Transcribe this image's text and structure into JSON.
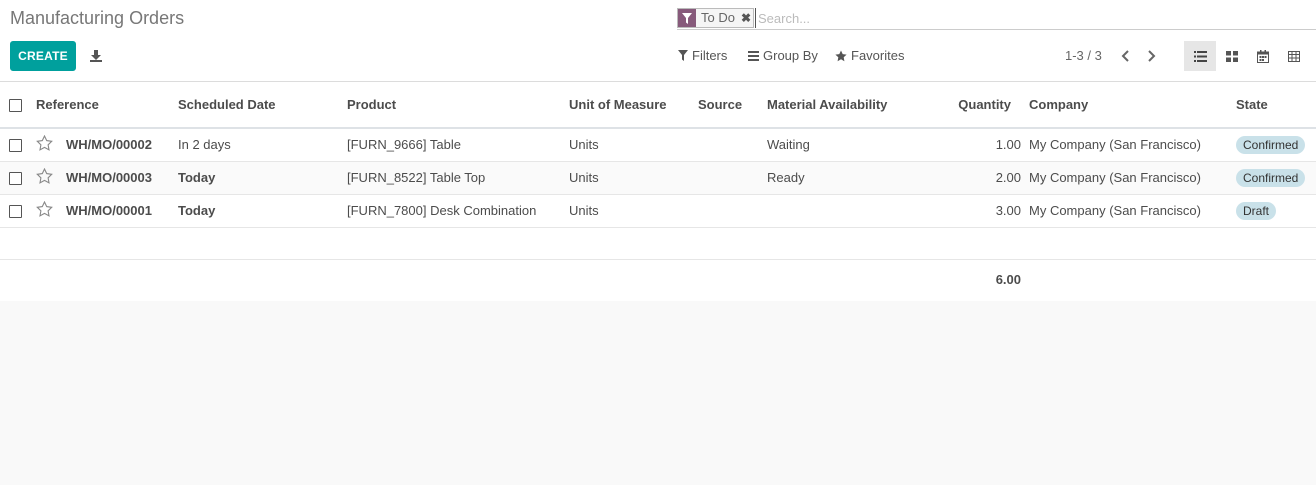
{
  "app": {
    "title": "Manufacturing Orders"
  },
  "toolbar": {
    "create_label": "CREATE",
    "export_icon": "download-icon"
  },
  "search": {
    "facet_icon": "filter-icon",
    "facet_label": "To Do",
    "facet_close": "✖",
    "placeholder": "Search..."
  },
  "search_options": {
    "filters": "Filters",
    "group_by": "Group By",
    "favorites": "Favorites"
  },
  "pager": {
    "value": "1-3 / 3"
  },
  "views": [
    "list-view-icon",
    "kanban-view-icon",
    "calendar-view-icon",
    "pivot-view-icon"
  ],
  "colors": {
    "accent": "#00a09d",
    "brand": "#875a7b",
    "today": "#d4883a",
    "badge": "#c9e1e9"
  },
  "table": {
    "columns": {
      "reference": "Reference",
      "scheduled_date": "Scheduled Date",
      "product": "Product",
      "uom": "Unit of Measure",
      "source": "Source",
      "availability": "Material Availability",
      "quantity": "Quantity",
      "company": "Company",
      "state": "State"
    },
    "rows": [
      {
        "reference": "WH/MO/00002",
        "scheduled_date": "In 2 days",
        "date_today": false,
        "product": "[FURN_9666] Table",
        "uom": "Units",
        "source": "",
        "availability": "Waiting",
        "quantity": "1.00",
        "company": "My Company (San Francisco)",
        "state": "Confirmed"
      },
      {
        "reference": "WH/MO/00003",
        "scheduled_date": "Today",
        "date_today": true,
        "product": "[FURN_8522] Table Top",
        "uom": "Units",
        "source": "",
        "availability": "Ready",
        "quantity": "2.00",
        "company": "My Company (San Francisco)",
        "state": "Confirmed"
      },
      {
        "reference": "WH/MO/00001",
        "scheduled_date": "Today",
        "date_today": true,
        "product": "[FURN_7800] Desk Combination",
        "uom": "Units",
        "source": "",
        "availability": "",
        "quantity": "3.00",
        "company": "My Company (San Francisco)",
        "state": "Draft"
      }
    ],
    "total_quantity": "6.00"
  }
}
